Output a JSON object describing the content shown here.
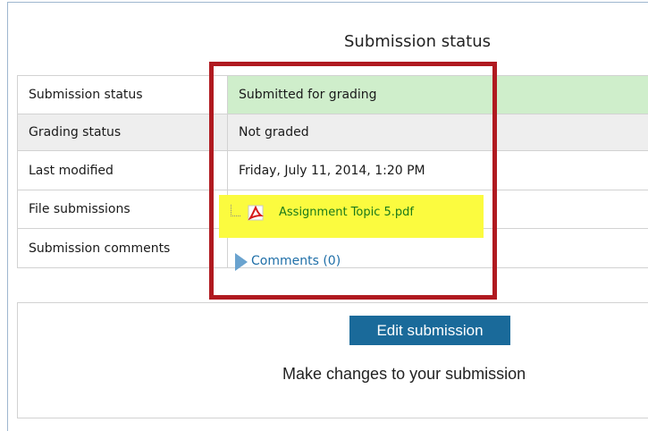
{
  "page": {
    "heading": "Submission status"
  },
  "status_rows": [
    {
      "label": "Submission status",
      "value": "Submitted for grading"
    },
    {
      "label": "Grading status",
      "value": "Not graded"
    },
    {
      "label": "Last modified",
      "value": "Friday, July 11, 2014, 1:20 PM"
    },
    {
      "label": "File submissions",
      "file_name": "Assignment Topic 5.pdf",
      "icon": "pdf-icon"
    },
    {
      "label": "Submission comments",
      "link": "Comments (0)",
      "icon": "expand-arrow-icon"
    }
  ],
  "actions": {
    "edit_button_label": "Edit submission",
    "edit_description": "Make changes to your submission"
  },
  "colors": {
    "submitted_bg": "#cfeecb",
    "not_graded_bg": "#eeeeee",
    "highlight": "#fbfb3f",
    "annotation_box": "#b01a20",
    "button_bg": "#1a6a9a",
    "link_color": "#1f6fa8"
  }
}
